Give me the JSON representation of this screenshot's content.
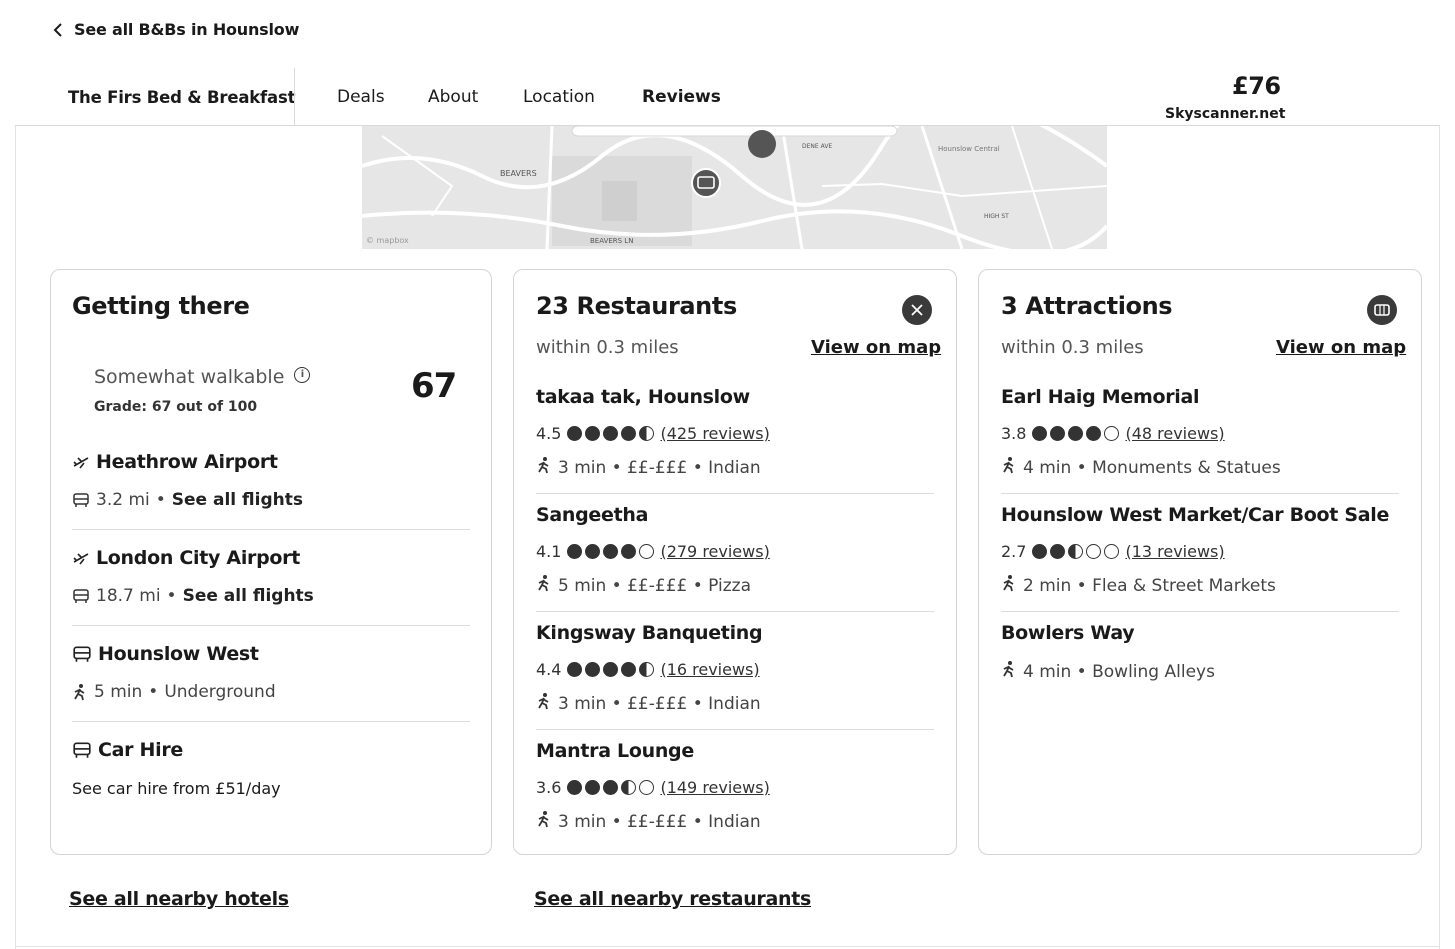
{
  "nav": {
    "back_label": "See all B&Bs in Hounslow",
    "hotel_name": "The Firs Bed & Breakfast",
    "tabs": [
      {
        "label": "Deals",
        "active": false
      },
      {
        "label": "About",
        "active": false
      },
      {
        "label": "Location",
        "active": false
      },
      {
        "label": "Reviews",
        "active": true
      }
    ],
    "price": "£76",
    "price_source": "Skyscanner.net"
  },
  "map": {
    "labels": [
      "BEAVERS",
      "BEAVERS LN",
      "Hounslow Central",
      "HIGH ST",
      "DENE AVE"
    ],
    "attribution": "© mapbox"
  },
  "getting_there": {
    "title": "Getting there",
    "walk_label": "Somewhat walkable",
    "grade_text": "Grade: 67 out of 100",
    "score": "67",
    "items": [
      {
        "icon": "plane-icon",
        "title": "Heathrow Airport",
        "sub_icon": "bus-icon",
        "distance": "3.2 mi",
        "link": "See all flights"
      },
      {
        "icon": "plane-icon",
        "title": "London City Airport",
        "sub_icon": "bus-icon",
        "distance": "18.7 mi",
        "link": "See all flights"
      },
      {
        "icon": "bus-icon",
        "title": "Hounslow West",
        "sub_icon": "walk-icon",
        "time": "5 min",
        "mode": "Underground"
      },
      {
        "icon": "bus-icon",
        "title": "Car Hire",
        "hire_text": "See car hire from £51/day"
      }
    ]
  },
  "restaurants": {
    "title": "23 Restaurants",
    "within": "within 0.3 miles",
    "view_map": "View on map",
    "items": [
      {
        "name": "takaa tak, Hounslow",
        "rating": "4.5",
        "score": 4.5,
        "reviews": "(425 reviews)",
        "meta": "3 min • ££-£££ • Indian"
      },
      {
        "name": "Sangeetha",
        "rating": "4.1",
        "score": 4.0,
        "reviews": "(279 reviews)",
        "meta": "5 min • ££-£££ • Pizza"
      },
      {
        "name": "Kingsway Banqueting",
        "rating": "4.4",
        "score": 4.5,
        "reviews": "(16 reviews)",
        "meta": "3 min • ££-£££ • Indian"
      },
      {
        "name": "Mantra Lounge",
        "rating": "3.6",
        "score": 3.5,
        "reviews": "(149 reviews)",
        "meta": "3 min • ££-£££ • Indian"
      }
    ]
  },
  "attractions": {
    "title": "3 Attractions",
    "within": "within 0.3 miles",
    "view_map": "View on map",
    "items": [
      {
        "name": "Earl Haig Memorial",
        "rating": "3.8",
        "score": 4.0,
        "reviews": "(48 reviews)",
        "meta": "4 min • Monuments & Statues"
      },
      {
        "name": "Hounslow West Market/Car Boot Sale",
        "rating": "2.7",
        "score": 2.5,
        "reviews": "(13 reviews)",
        "meta": "2 min • Flea & Street Markets"
      },
      {
        "name": "Bowlers Way",
        "meta": "4 min • Bowling Alleys"
      }
    ]
  },
  "footer": {
    "hotels_link": "See all nearby hotels",
    "restaurants_link": "See all nearby restaurants"
  }
}
